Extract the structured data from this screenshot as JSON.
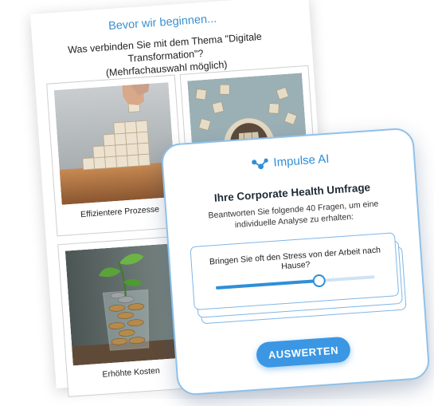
{
  "survey": {
    "title": "Bevor wir beginnen...",
    "question": "Was verbinden Sie mit dem Thema \"Digitale Transformation\"?",
    "question_hint": "(Mehrfachauswahl möglich)",
    "tiles": [
      {
        "caption": "Effizientere Prozesse",
        "image": "stacked-wooden-blocks-photo"
      },
      {
        "caption": "",
        "image": "puzzle-pieces-wall-photo"
      },
      {
        "caption": "Erhöhte Kosten",
        "image": "coins-in-glass-plant-photo"
      },
      {
        "caption": "",
        "image": "hidden-photo"
      }
    ]
  },
  "impulse": {
    "brand": "Impulse AI",
    "brand_color": "#2e8fd8",
    "title": "Ihre Corporate Health Umfrage",
    "subtitle": "Beantworten Sie folgende 40 Fragen, um eine individuelle Analyse zu erhalten:",
    "question": "Bringen Sie oft den Stress von der Arbeit nach Hause?",
    "slider_value": 0.65,
    "submit_label": "AUSWERTEN"
  }
}
